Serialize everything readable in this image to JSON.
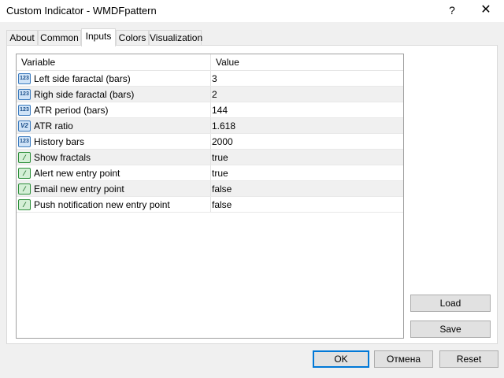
{
  "window": {
    "title": "Custom Indicator - WMDFpattern",
    "help_label": "?",
    "close_label": "✕"
  },
  "tabs": [
    {
      "label": "About"
    },
    {
      "label": "Common"
    },
    {
      "label": "Inputs",
      "active": true
    },
    {
      "label": "Colors"
    },
    {
      "label": "Visualization"
    }
  ],
  "grid": {
    "header_variable": "Variable",
    "header_value": "Value",
    "rows": [
      {
        "icon": "int-icon",
        "icon_text": "123",
        "variable": "Left side faractal (bars)",
        "value": "3"
      },
      {
        "icon": "int-icon",
        "icon_text": "123",
        "variable": "Righ side faractal (bars)",
        "value": "2"
      },
      {
        "icon": "int-icon",
        "icon_text": "123",
        "variable": "ATR period (bars)",
        "value": "144"
      },
      {
        "icon": "double-icon",
        "icon_text": "V2",
        "variable": "ATR ratio",
        "value": "1.618"
      },
      {
        "icon": "int-icon",
        "icon_text": "123",
        "variable": "History bars",
        "value": "2000"
      },
      {
        "icon": "bool-icon",
        "icon_text": "⁄",
        "variable": "Show fractals",
        "value": "true"
      },
      {
        "icon": "bool-icon",
        "icon_text": "⁄",
        "variable": "Alert new entry point",
        "value": "true"
      },
      {
        "icon": "bool-icon",
        "icon_text": "⁄",
        "variable": "Email new entry point",
        "value": "false"
      },
      {
        "icon": "bool-icon",
        "icon_text": "⁄",
        "variable": "Push notification new entry point",
        "value": "false"
      }
    ]
  },
  "side_buttons": {
    "load": "Load",
    "save": "Save"
  },
  "footer": {
    "ok": "OK",
    "cancel": "Отмена",
    "reset": "Reset"
  }
}
